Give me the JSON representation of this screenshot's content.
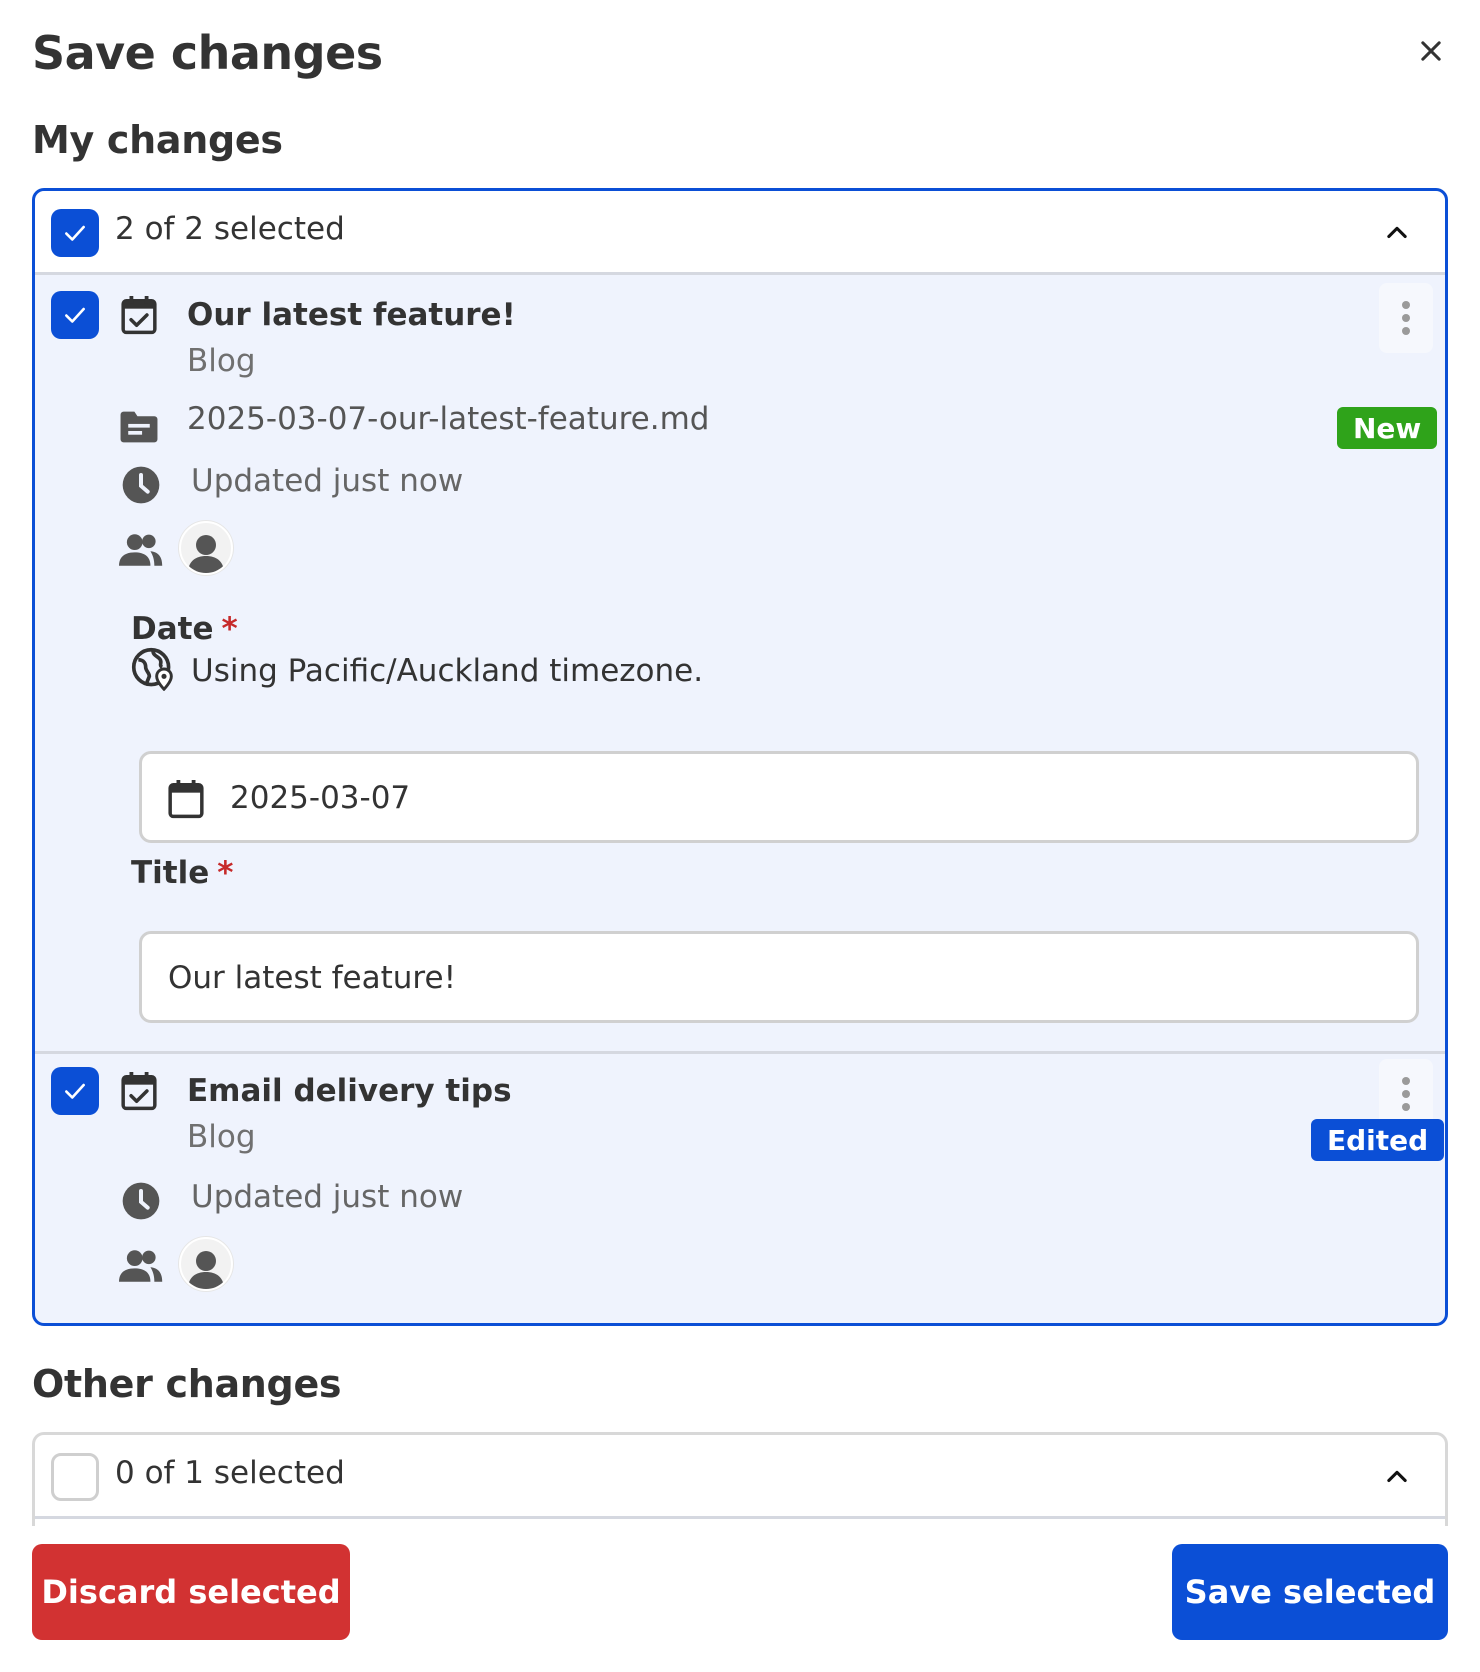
{
  "dialog": {
    "title": "Save changes",
    "close_icon": "close-icon"
  },
  "my_changes": {
    "heading": "My changes",
    "selection_label": "2 of 2 selected",
    "all_checked": true,
    "items": [
      {
        "checked": true,
        "type_icon": "calendar-check-icon",
        "title": "Our latest feature!",
        "collection": "Blog",
        "filename": "2025-03-07-our-latest-feature.md",
        "badge": "New",
        "updated": "Updated just now",
        "fields": {
          "date": {
            "label": "Date",
            "required_mark": "*",
            "timezone_note": "Using Pacific/Auckland timezone.",
            "value": "2025-03-07"
          },
          "title": {
            "label": "Title",
            "required_mark": "*",
            "value": "Our latest feature!"
          }
        }
      },
      {
        "checked": true,
        "type_icon": "calendar-check-icon",
        "title": "Email delivery tips",
        "collection": "Blog",
        "badge": "Edited",
        "updated": "Updated just now"
      }
    ]
  },
  "other_changes": {
    "heading": "Other changes",
    "selection_label": "0 of 1 selected",
    "all_checked": false
  },
  "actions": {
    "discard_label": "Discard selected",
    "save_label": "Save selected"
  },
  "colors": {
    "primary": "#0b4fd6",
    "danger": "#d23232",
    "success": "#2fa31a",
    "required": "#c62a2a"
  }
}
